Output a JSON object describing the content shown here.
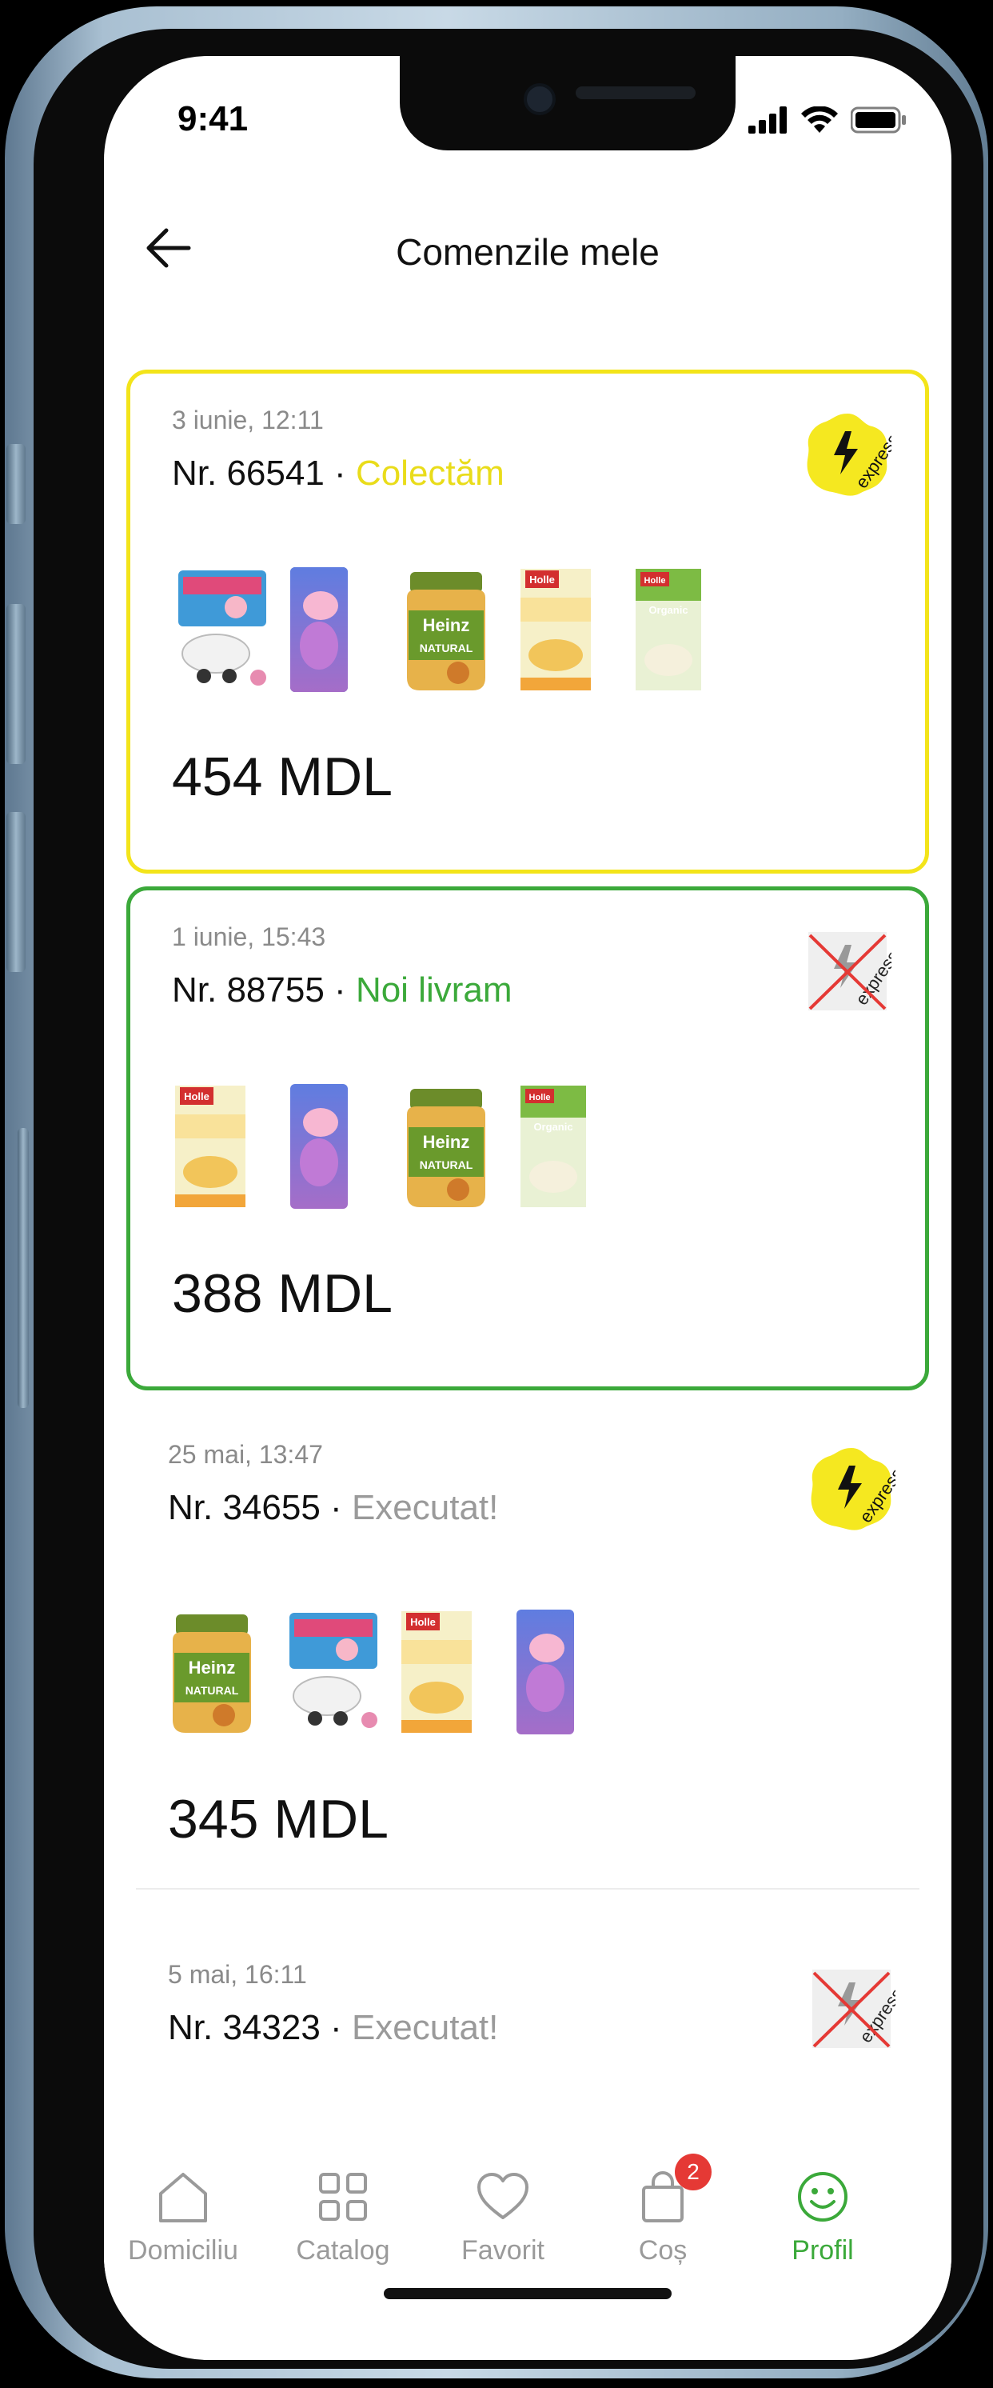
{
  "status_bar": {
    "time": "9:41"
  },
  "header": {
    "title": "Comenzile mele"
  },
  "orders": [
    {
      "date": "3 iunie, 12:11",
      "number": "Nr. 66541",
      "separator": "·",
      "status": "Colectăm",
      "total": "454 MDL",
      "express": true,
      "products": [
        "peppa-plane-toy",
        "peppa-plush",
        "heinz-natural-jar",
        "holle-milk-cereal",
        "holle-organic-spelt"
      ]
    },
    {
      "date": "1 iunie, 15:43",
      "number": "Nr. 88755",
      "separator": "·",
      "status": "Noi livram",
      "total": "388 MDL",
      "express": false,
      "products": [
        "holle-milk-cereal",
        "peppa-plush",
        "heinz-natural-jar",
        "holle-organic-spelt"
      ]
    },
    {
      "date": "25 mai, 13:47",
      "number": "Nr. 34655",
      "separator": "·",
      "status": "Executat!",
      "total": "345 MDL",
      "express": true,
      "products": [
        "heinz-natural-jar",
        "peppa-plane-toy",
        "holle-milk-cereal",
        "peppa-plush"
      ]
    },
    {
      "date": "5 mai, 16:11",
      "number": "Nr. 34323",
      "separator": "·",
      "status": "Executat!",
      "express": false
    }
  ],
  "badge_text": {
    "express": "express"
  },
  "tabbar": {
    "items": [
      {
        "label": "Domiciliu",
        "icon": "home-icon"
      },
      {
        "label": "Catalog",
        "icon": "grid-icon"
      },
      {
        "label": "Favorit",
        "icon": "heart-icon"
      },
      {
        "label": "Coș",
        "icon": "bag-icon",
        "badge": "2"
      },
      {
        "label": "Profil",
        "icon": "smile-icon",
        "active": true
      }
    ]
  },
  "colors": {
    "yellow": "#f3e41a",
    "green": "#3ba93a",
    "badge_red": "#e53935"
  }
}
